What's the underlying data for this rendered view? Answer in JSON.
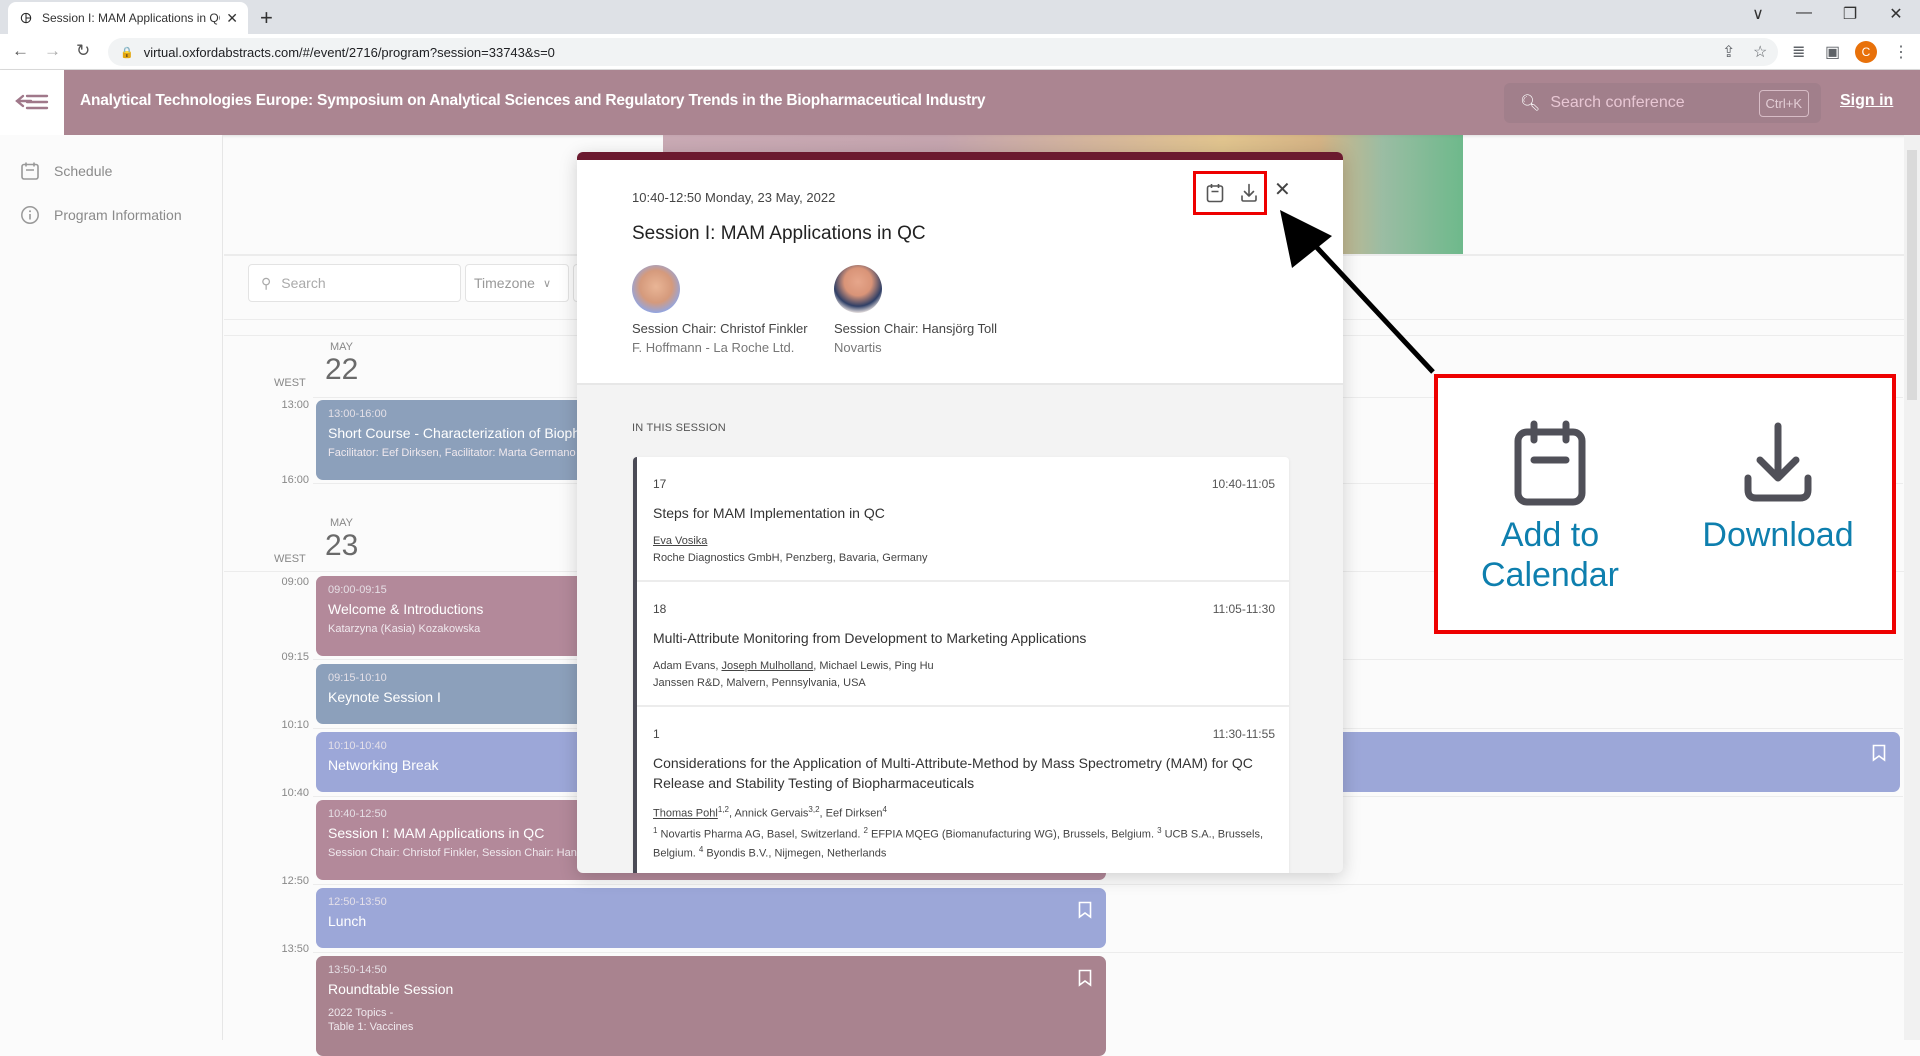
{
  "browser": {
    "tab_title": "Session I: MAM Applications in QC",
    "tab_favicon": "oxford-abstracts-icon",
    "url": "virtual.oxfordabstracts.com/#/event/2716/program?session=33743&s=0",
    "profile_initial": "C"
  },
  "header": {
    "title": "Analytical Technologies Europe: Symposium on Analytical Sciences and Regulatory Trends in the Biopharmaceutical Industry",
    "search_placeholder": "Search conference",
    "search_shortcut": "Ctrl+K",
    "signin_label": "Sign in"
  },
  "sidebar": {
    "items": [
      {
        "label": "Schedule",
        "icon": "calendar-icon"
      },
      {
        "label": "Program Information",
        "icon": "info-icon"
      }
    ]
  },
  "filters": {
    "search_placeholder": "Search",
    "timezone_label": "Timezone"
  },
  "schedule": {
    "days": [
      {
        "month": "MAY",
        "day": "22",
        "tz": "WEST",
        "times": [
          "13:00",
          "16:00"
        ],
        "events": [
          {
            "time": "13:00-16:00",
            "name": "Short Course - Characterization of Biopharmaceuticals",
            "sub": "Facilitator: Eef Dirksen, Facilitator: Marta Germano",
            "color": "blue"
          }
        ]
      },
      {
        "month": "MAY",
        "day": "23",
        "tz": "WEST",
        "times": [
          "09:00",
          "09:15",
          "10:10",
          "10:40",
          "12:50",
          "13:50"
        ],
        "events": [
          {
            "time": "09:00-09:15",
            "name": "Welcome & Introductions",
            "sub": "Katarzyna (Kasia) Kozakowska",
            "color": "rose"
          },
          {
            "time": "09:15-10:10",
            "name": "Keynote Session I",
            "sub": "",
            "color": "blue"
          },
          {
            "time": "10:10-10:40",
            "name": "Networking Break",
            "sub": "",
            "color": "lavender"
          },
          {
            "time": "10:40-12:50",
            "name": "Session I: MAM Applications in QC",
            "sub": "Session Chair: Christof Finkler, Session Chair: Hansjörg Toll",
            "color": "rose"
          },
          {
            "time": "12:50-13:50",
            "name": "Lunch",
            "sub": "",
            "color": "lavender"
          },
          {
            "time": "13:50-14:50",
            "name": "Roundtable Session",
            "sub": "2022 Topics -",
            "sub2": "Table 1: Vaccines",
            "color": "plum"
          }
        ]
      }
    ]
  },
  "modal": {
    "datetime": "10:40-12:50 Monday, 23 May, 2022",
    "title": "Session I: MAM Applications in QC",
    "chairs": [
      {
        "role": "Session Chair: Christof Finkler",
        "org": "F. Hoffmann - La Roche Ltd."
      },
      {
        "role": "Session Chair: Hansjörg Toll",
        "org": "Novartis"
      }
    ],
    "section_label": "IN THIS SESSION",
    "talks": [
      {
        "number": "17",
        "time": "10:40-11:05",
        "title": "Steps for MAM Implementation in QC",
        "presenter": "Eva Vosika",
        "affiliation": "Roche Diagnostics GmbH, Penzberg, Bavaria, Germany"
      },
      {
        "number": "18",
        "time": "11:05-11:30",
        "title": "Multi-Attribute Monitoring from Development to Marketing Applications",
        "authors_before": "Adam Evans, ",
        "presenter": "Joseph Mulholland",
        "authors_after": ", Michael Lewis, Ping Hu",
        "affiliation": "Janssen R&D, Malvern, Pennsylvania, USA"
      },
      {
        "number": "1",
        "time": "11:30-11:55",
        "title": "Considerations for the Application of Multi-Attribute-Method by Mass Spectrometry (MAM) for QC Release and Stability Testing of Biopharmaceuticals",
        "presenter": "Thomas Pohl",
        "presenter_sup": "1,2",
        "author2": ", Annick Gervais",
        "author2_sup": "3,2",
        "author3": ", Eef Dirksen",
        "author3_sup": "4",
        "aff1_sup": "1",
        "aff1": " Novartis Pharma AG, Basel, Switzerland. ",
        "aff2_sup": "2",
        "aff2": " EFPIA MQEG (Biomanufacturing WG), Brussels, Belgium. ",
        "aff3_sup": "3",
        "aff3": " UCB S.A., Brussels, Belgium. ",
        "aff4_sup": "4",
        "aff4": " Byondis B.V., Nijmegen, Netherlands"
      }
    ]
  },
  "annotation": {
    "add_to_calendar_line1": "Add to",
    "add_to_calendar_line2": "Calendar",
    "download_label": "Download",
    "highlight_color": "#ee0000",
    "label_color": "#0e7fae"
  }
}
